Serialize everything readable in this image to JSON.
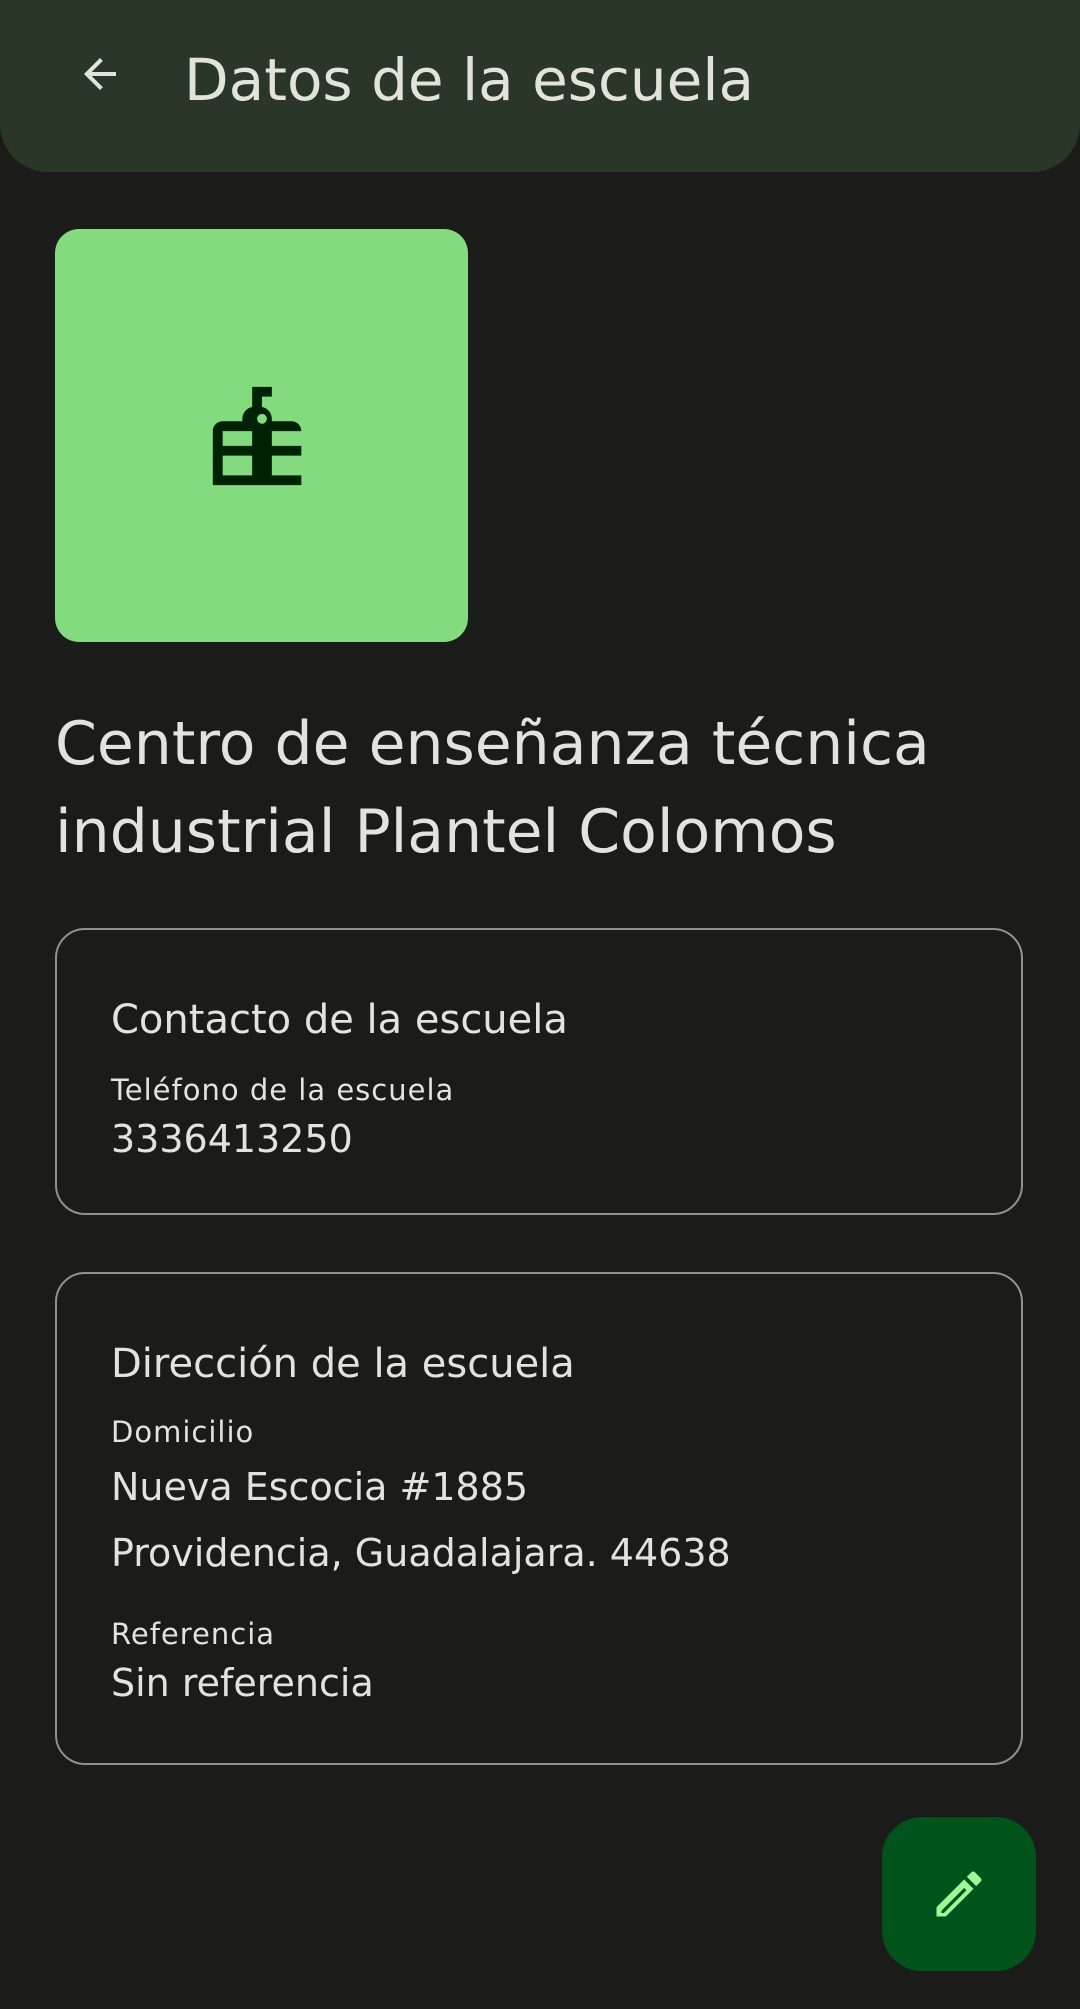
{
  "app_bar": {
    "title": "Datos de la escuela",
    "back_icon": "arrow-back-icon"
  },
  "hero": {
    "icon": "school-icon",
    "background_color": "#83da7f",
    "icon_color": "#002204"
  },
  "school": {
    "name": "Centro de enseñanza técnica industrial Plantel Colomos"
  },
  "contact_card": {
    "title": "Contacto de la escuela",
    "phone_label": "Teléfono de la escuela",
    "phone_value": "3336413250"
  },
  "address_card": {
    "title": "Dirección de la escuela",
    "address_label": "Domicilio",
    "address_line1": "Nueva Escocia #1885",
    "address_line2": "Providencia, Guadalajara. 44638",
    "reference_label": "Referencia",
    "reference_value": "Sin referencia"
  },
  "fab": {
    "icon": "edit-pencil-icon",
    "background_color": "#00531a",
    "icon_color": "#9ff798"
  },
  "colors": {
    "background": "#1b1c1a",
    "app_bar": "#2a3628",
    "text": "#e2e3dd",
    "outline": "#8e928b"
  }
}
